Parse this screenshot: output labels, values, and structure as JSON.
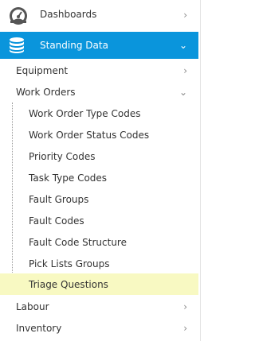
{
  "menu": {
    "dashboards": {
      "label": "Dashboards",
      "icon": "speedometer-icon",
      "chevron": "›"
    },
    "standing_data": {
      "label": "Standing Data",
      "icon": "database-icon",
      "chevron": "⌄",
      "active_color": "#0a95dc"
    },
    "equipment": {
      "label": "Equipment",
      "chevron": "›"
    },
    "work_orders": {
      "label": "Work Orders",
      "chevron": "⌄",
      "items": [
        {
          "label": "Work Order Type Codes"
        },
        {
          "label": "Work Order Status Codes"
        },
        {
          "label": "Priority Codes"
        },
        {
          "label": "Task Type Codes"
        },
        {
          "label": "Fault Groups"
        },
        {
          "label": "Fault Codes"
        },
        {
          "label": "Fault Code Structure"
        },
        {
          "label": "Pick Lists Groups"
        },
        {
          "label": "Triage Questions",
          "highlight_color": "#f8f9c2"
        }
      ]
    },
    "labour": {
      "label": "Labour",
      "chevron": "›"
    },
    "inventory": {
      "label": "Inventory",
      "chevron": "›"
    }
  }
}
